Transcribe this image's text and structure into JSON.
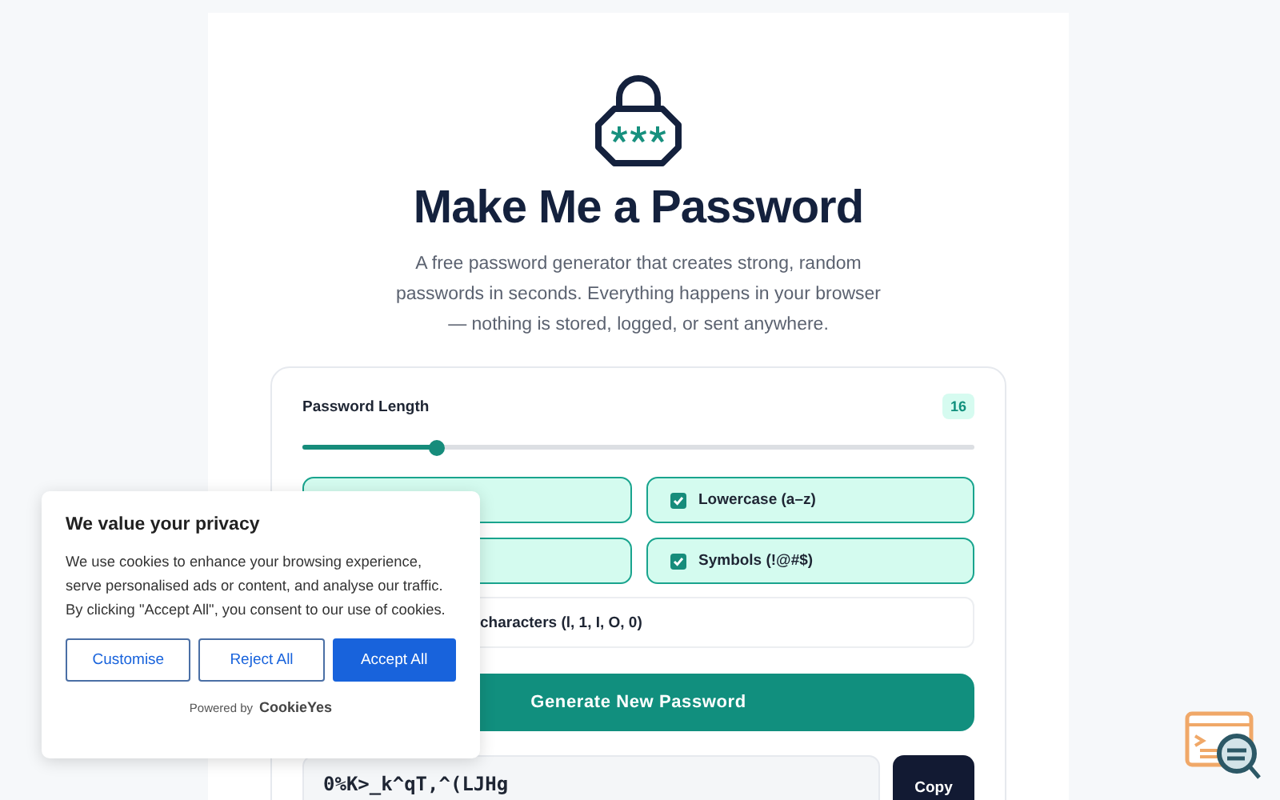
{
  "header": {
    "title": "Make Me a Password",
    "subtitle": "A free password generator that creates strong, random passwords in seconds. Everything happens in your browser — nothing is stored, logged, or sent anywhere."
  },
  "generator": {
    "length_label": "Password Length",
    "length_value": "16",
    "length_slider": {
      "level": 0.2
    },
    "options": [
      {
        "covered": true
      },
      {
        "covered": false,
        "label": "Lowercase (a–z)",
        "checked": true
      },
      {
        "covered": true
      },
      {
        "covered": false,
        "label": "Symbols (!@#$)",
        "checked": true
      }
    ],
    "exclude_row": {
      "label": "characters (l, 1, I, O, 0)"
    },
    "generate_button": "Generate New Password",
    "password": "0%K>_k^qT,^(LJHg",
    "copy_button": "Copy"
  },
  "cookie_banner": {
    "title": "We value your privacy",
    "text": "We use cookies to enhance your browsing experience, serve personalised ads or content, and analyse our traffic. By clicking \"Accept All\", you consent to our use of cookies.",
    "buttons": [
      {
        "label": "Customise",
        "kind": "outline"
      },
      {
        "label": "Reject All",
        "kind": "outline"
      },
      {
        "label": "Accept All",
        "kind": "primary"
      }
    ],
    "powered_by": "Powered by",
    "brand": "CookieYes"
  }
}
